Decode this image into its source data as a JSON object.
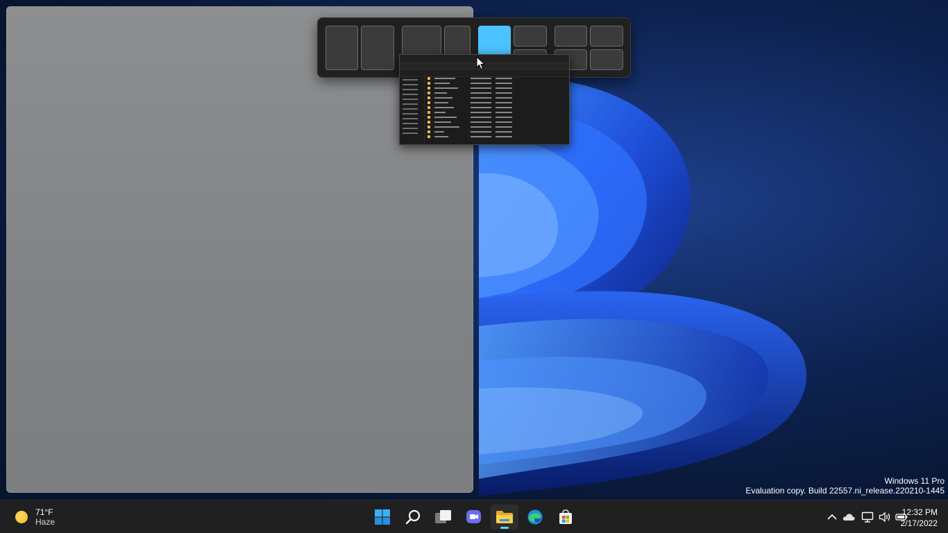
{
  "watermark": {
    "edition": "Windows 11 Pro",
    "build": "Evaluation copy. Build 22557.ni_release.220210-1445"
  },
  "weather": {
    "temperature": "71°F",
    "condition": "Haze",
    "icon": "sun-icon"
  },
  "taskbar": {
    "apps": [
      {
        "name": "start",
        "icon": "windows-logo-icon"
      },
      {
        "name": "search",
        "icon": "search-icon"
      },
      {
        "name": "task-view",
        "icon": "task-view-icon"
      },
      {
        "name": "chat",
        "icon": "teams-chat-icon"
      },
      {
        "name": "file-explorer",
        "icon": "folder-icon",
        "active": true
      },
      {
        "name": "edge",
        "icon": "edge-icon"
      },
      {
        "name": "store",
        "icon": "store-icon"
      }
    ]
  },
  "tray": {
    "icons": [
      "chevron-up-icon",
      "onedrive-cloud-icon",
      "network-icon",
      "volume-icon",
      "battery-icon"
    ]
  },
  "clock": {
    "time": "12:32 PM",
    "date": "2/17/2022"
  },
  "snap_layouts": {
    "active_layout": 3,
    "active_zone": "left-half"
  },
  "colors": {
    "accent": "#4cc2ff",
    "taskbar": "#202020",
    "indicator": "#60cdff"
  }
}
